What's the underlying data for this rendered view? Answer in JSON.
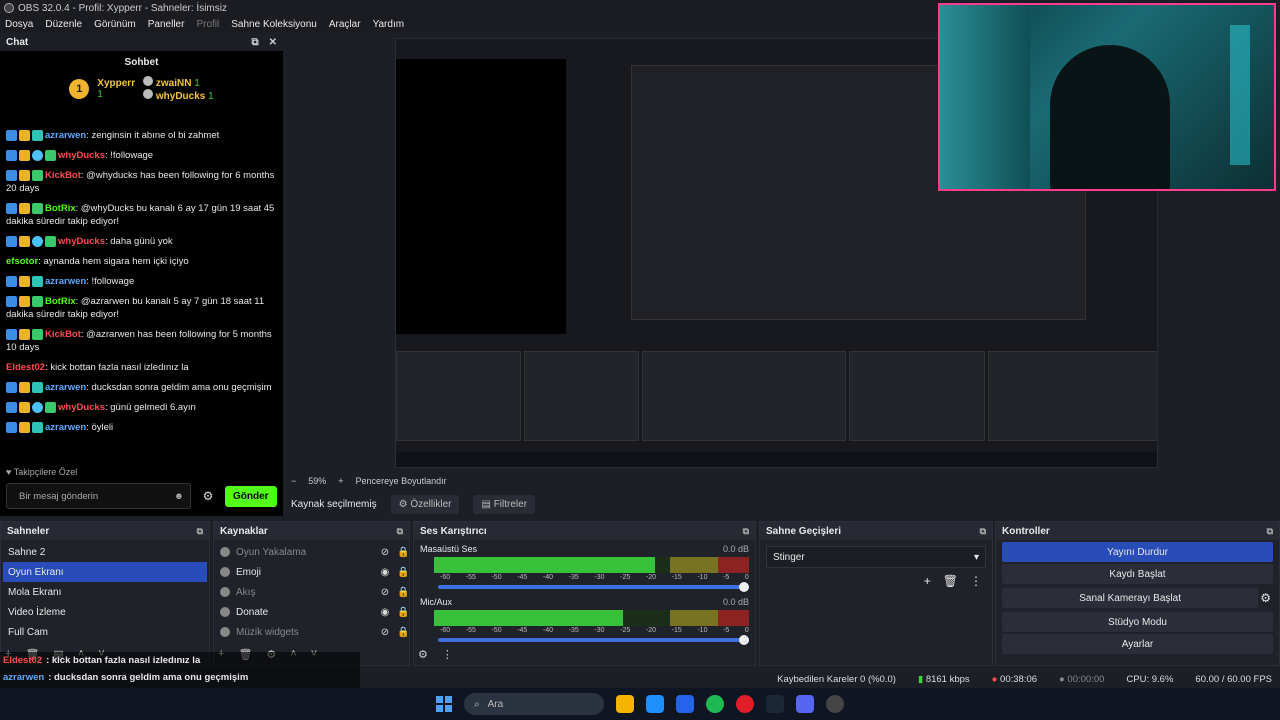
{
  "window": {
    "title": "OBS 32.0.4 - Profil: Xypperr - Sahneler: İsimsiz"
  },
  "menu": [
    "Dosya",
    "Düzenle",
    "Görünüm",
    "Paneller",
    "Profil",
    "Sahne Koleksiyonu",
    "Araçlar",
    "Yardım"
  ],
  "chat": {
    "dock_title": "Chat",
    "title": "Sohbet",
    "leaders": [
      {
        "rank": "1",
        "name": "Xypperr",
        "count": "1"
      },
      {
        "name": "zwaiNN",
        "count": "1"
      },
      {
        "name": "whyDucks",
        "count": "1"
      }
    ],
    "messages": [
      {
        "user": "azrarwen",
        "color": "#5ea9ff",
        "text": ": zenginsin it abıne ol bi zahmet"
      },
      {
        "user": "whyDucks",
        "color": "#ff4d4d",
        "text": ": !followage"
      },
      {
        "user": "KickBot",
        "color": "#ff4d4d",
        "text": ": @whyducks has been following for 6 months 20 days"
      },
      {
        "user": "BotRix",
        "color": "#53fc18",
        "text": ": @whyDucks bu kanalı 6 ay 17 gün 19 saat 45 dakika süredir takip ediyor!"
      },
      {
        "user": "whyDucks",
        "color": "#ff4d4d",
        "text": ": daha günü yok"
      },
      {
        "user": "efsotor",
        "color": "#53fc18",
        "text": ": aynanda hem sigara hem içki içiyo"
      },
      {
        "user": "azrarwen",
        "color": "#5ea9ff",
        "text": ": !followage"
      },
      {
        "user": "BotRix",
        "color": "#53fc18",
        "text": ": @azrarwen bu kanalı 5 ay 7 gün 18 saat 11 dakika süredir takip ediyor!"
      },
      {
        "user": "KickBot",
        "color": "#ff4d4d",
        "text": ": @azrarwen has been following for 5 months 10 days"
      },
      {
        "user": "Eldest02",
        "color": "#ff4d4d",
        "text": ": kick bottan fazla nasıl izledınız la"
      },
      {
        "user": "azrarwen",
        "color": "#5ea9ff",
        "text": ": ducksdan sonra geldim ama onu geçmişim"
      },
      {
        "user": "whyDucks",
        "color": "#ff4d4d",
        "text": ": günü gelmedi 6.ayın"
      },
      {
        "user": "azrarwen",
        "color": "#5ea9ff",
        "text": ": öyleli"
      }
    ],
    "followers_label": "Takipçilere Özel",
    "input_placeholder": "Bir mesaj gönderin",
    "send_label": "Gönder"
  },
  "preview_bar": {
    "zoom": "59%",
    "fit": "Pencereye Boyutlandır"
  },
  "source_bar": {
    "status": "Kaynak seçilmemiş",
    "properties": "Özellikler",
    "filters": "Filtreler"
  },
  "scenes": {
    "title": "Sahneler",
    "items": [
      "Sahne 2",
      "Oyun Ekranı",
      "Mola Ekranı",
      "Video İzleme",
      "Full Cam"
    ],
    "selected": 1
  },
  "sources": {
    "title": "Kaynaklar",
    "items": [
      {
        "name": "Oyun Yakalama",
        "hidden": true
      },
      {
        "name": "Emoji",
        "hidden": false
      },
      {
        "name": "Akış",
        "hidden": true
      },
      {
        "name": "Donate",
        "hidden": false
      },
      {
        "name": "Müzik widgets",
        "hidden": true
      }
    ]
  },
  "mixer": {
    "title": "Ses Karıştırıcı",
    "channels": [
      {
        "name": "Masaüstü Ses",
        "db": "0.0 dB",
        "level": 0.7
      },
      {
        "name": "Mic/Aux",
        "db": "0.0 dB",
        "level": 0.6
      }
    ],
    "ticks": [
      "-60",
      "-55",
      "-50",
      "-45",
      "-40",
      "-35",
      "-30",
      "-25",
      "-20",
      "-15",
      "-10",
      "-5",
      "0"
    ]
  },
  "transitions": {
    "title": "Sahne Geçişleri",
    "selected": "Stinger"
  },
  "controls": {
    "title": "Kontroller",
    "buttons": [
      "Yayını Durdur",
      "Kaydı Başlat",
      "Sanal Kamerayı Başlat",
      "Stüdyo Modu",
      "Ayarlar"
    ]
  },
  "status": {
    "dropped": "Kaybedilen Kareler 0 (%0.0)",
    "bitrate": "8161 kbps",
    "stream_time": "00:38:06",
    "rec_time": "00:00:00",
    "cpu": "CPU: 9.6%",
    "fps": "60.00 / 60.00 FPS"
  },
  "overlay": [
    {
      "user": "Eldest02",
      "color": "#ff4d4d",
      "text": ": kick bottan fazla nasıl izledınız la"
    },
    {
      "user": "azrarwen",
      "color": "#5ea9ff",
      "text": ": ducksdan sonra geldim ama onu geçmişim"
    },
    {
      "user": "whyDucks",
      "color": "#ff4d4d",
      "text": ": günü gelmedi 6.ayın"
    },
    {
      "user": "azrarwen",
      "color": "#5ea9ff",
      "text": ": öyleli"
    }
  ],
  "taskbar": {
    "search_placeholder": "Ara"
  }
}
